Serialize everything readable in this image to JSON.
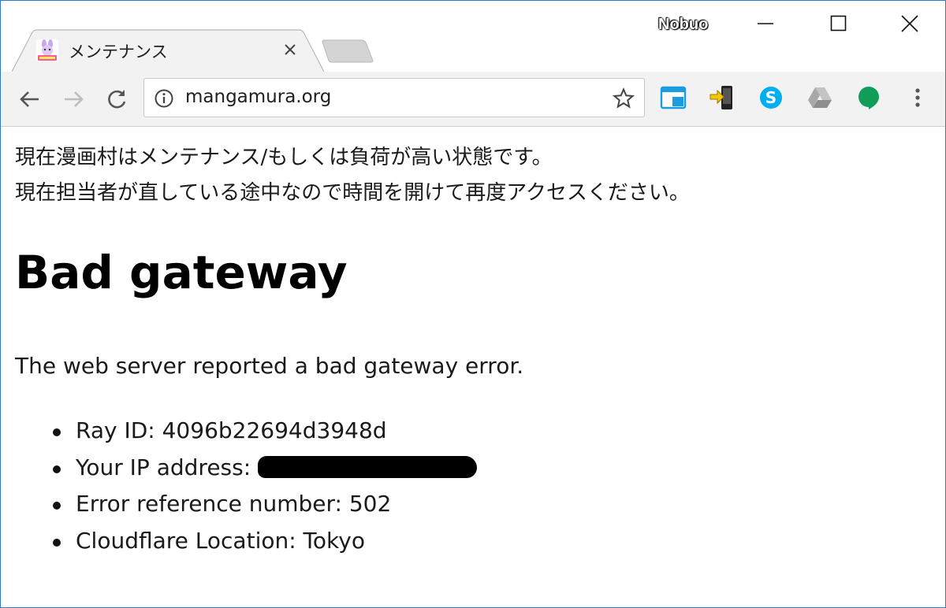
{
  "browser": {
    "profile_name": "Nobuo",
    "tab": {
      "title": "メンテナンス",
      "favicon": "comic-manga-favicon"
    },
    "address_bar": {
      "url": "mangamura.org"
    },
    "extensions": [
      "window-extension-icon",
      "phone-transfer-icon",
      "skype-icon",
      "google-drive-icon",
      "hangouts-icon"
    ]
  },
  "page": {
    "notice_lines": [
      "現在漫画村はメンテナンス/もしくは負荷が高い状態です。",
      "現在担当者が直している途中なので時間を開けて再度アクセスください。"
    ],
    "error_title": "Bad gateway",
    "error_description": "The web server reported a bad gateway error.",
    "details": {
      "ray_id": "Ray ID: 4096b22694d3948d",
      "ip_label": "Your IP address: ",
      "error_reference": "Error reference number: 502",
      "location": "Cloudflare Location: Tokyo"
    }
  },
  "colors": {
    "window_border": "#2b78d4",
    "toolbar_bg": "#f2f2f2",
    "skype_blue": "#00aff0",
    "hangouts_green": "#0f9d58"
  }
}
